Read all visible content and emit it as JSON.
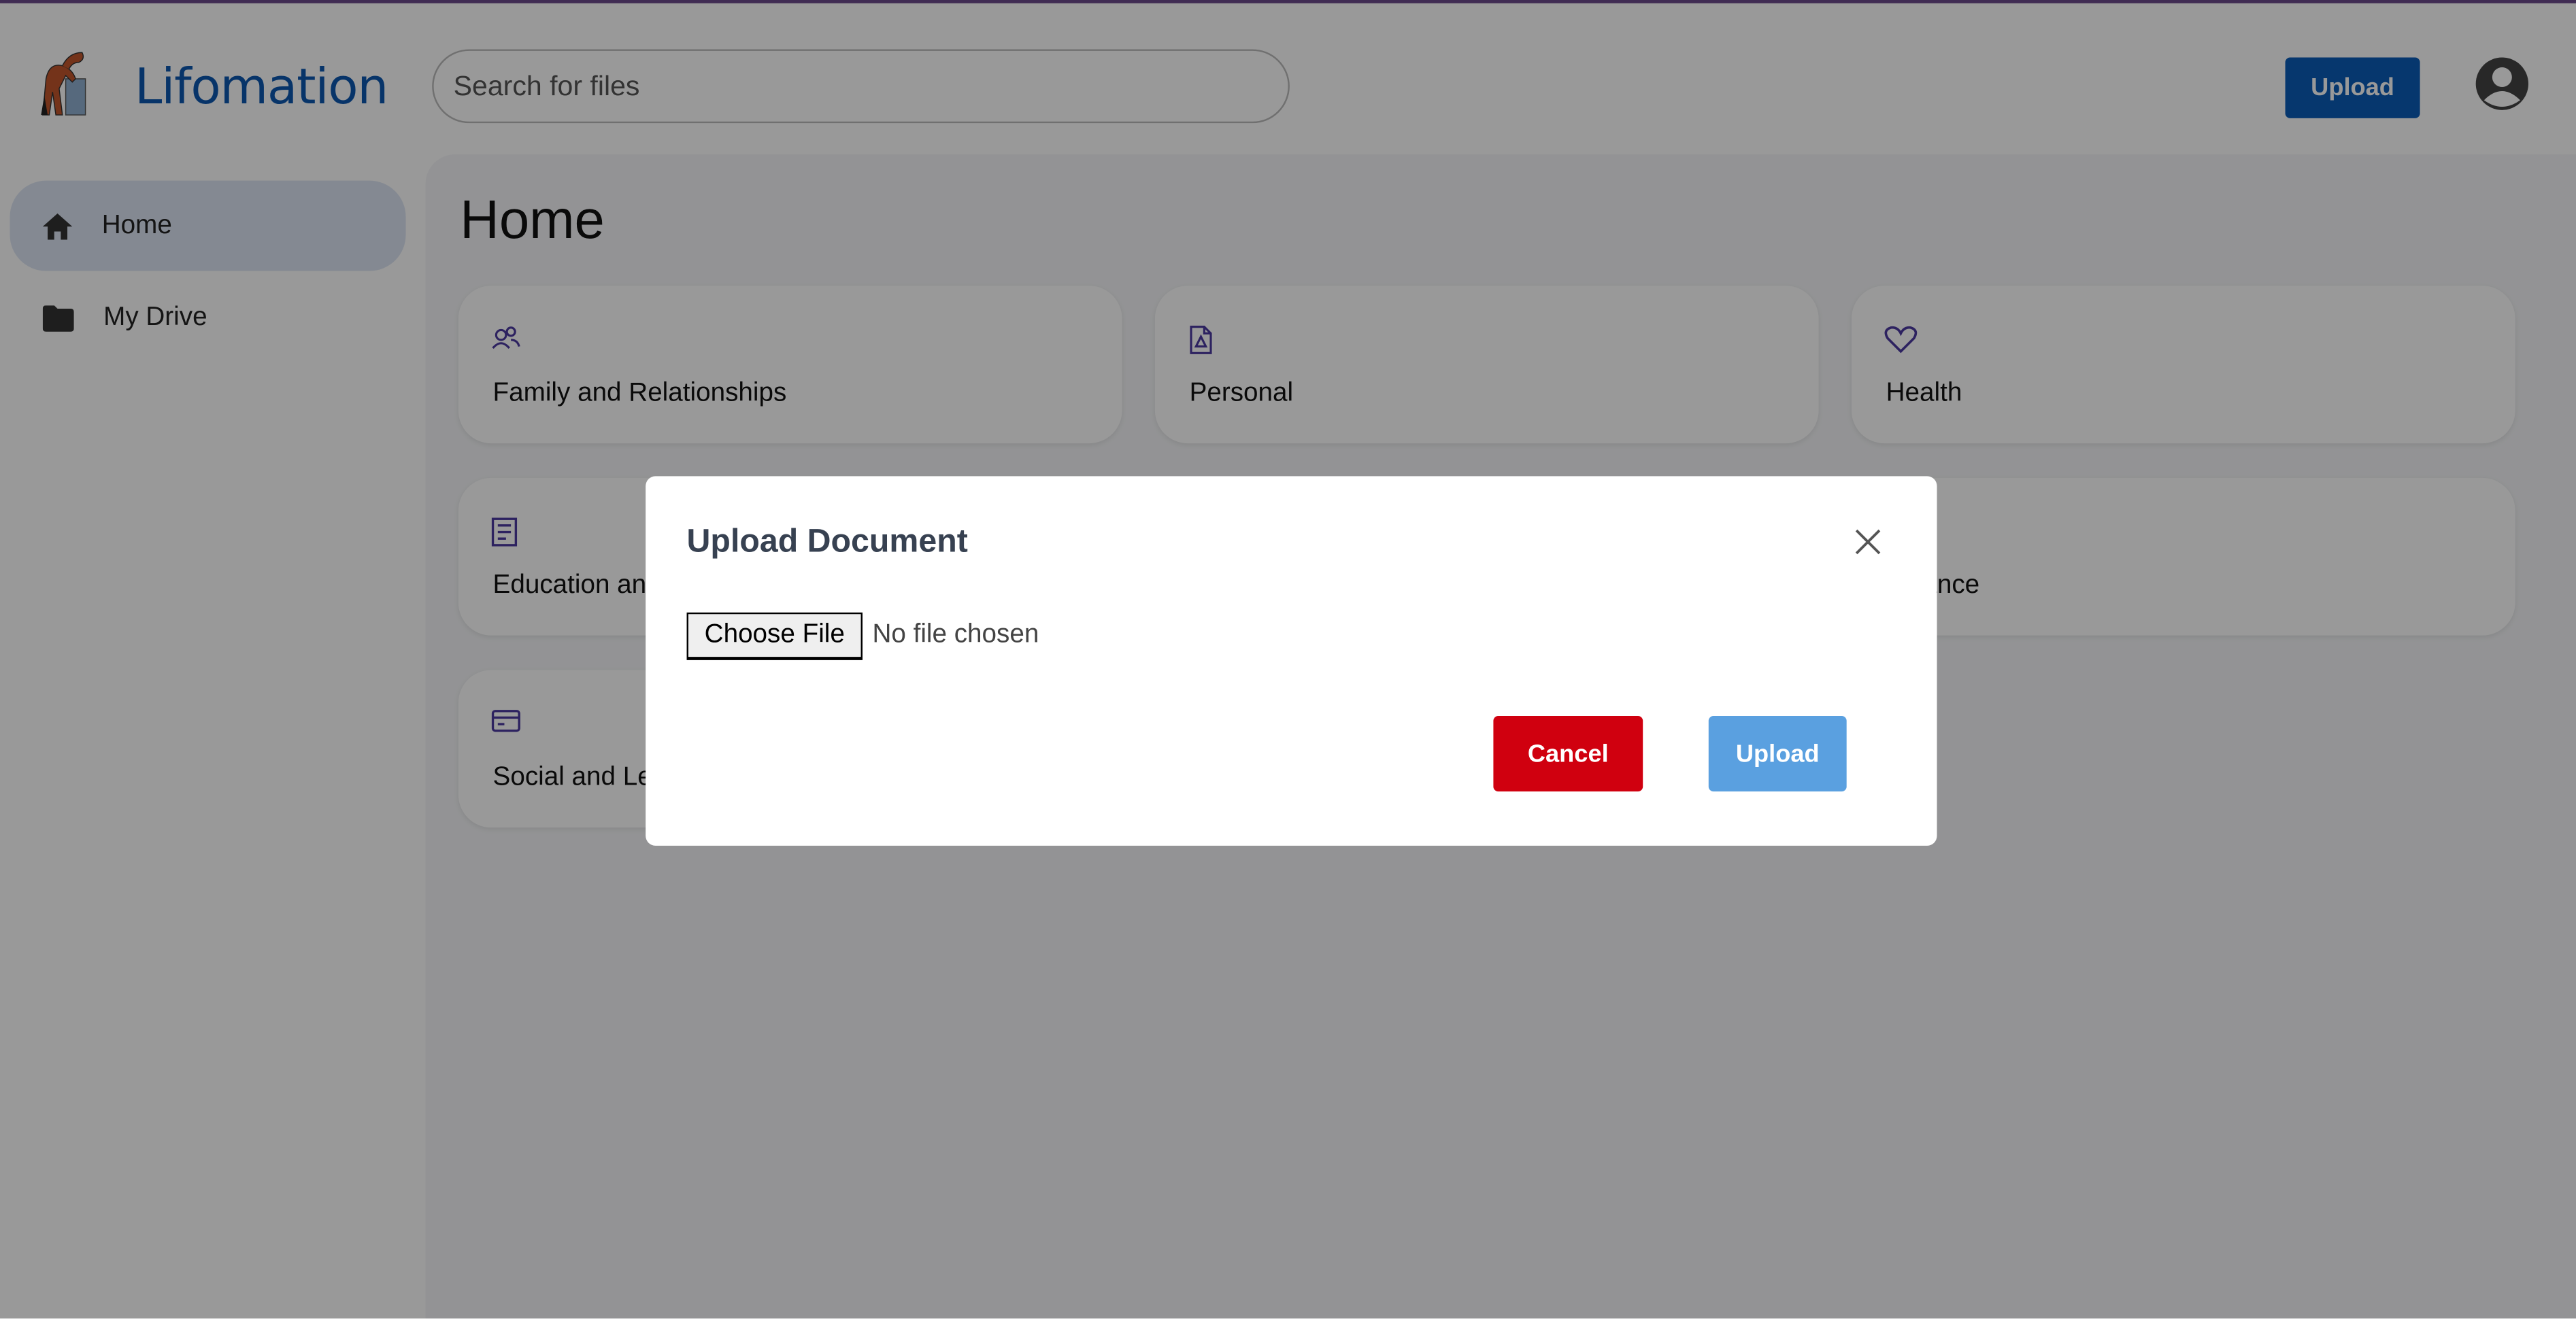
{
  "header": {
    "brand": "Lifomation",
    "search_placeholder": "Search for files",
    "upload_label": "Upload",
    "brand_color": "#0d57b0"
  },
  "sidebar": {
    "items": [
      {
        "label": "Home",
        "icon": "home-icon",
        "active": true
      },
      {
        "label": "My Drive",
        "icon": "folder-icon",
        "active": false
      }
    ]
  },
  "main": {
    "title": "Home",
    "categories": [
      {
        "label": "Family and Relationships",
        "icon": "users-icon"
      },
      {
        "label": "Personal",
        "icon": "file-pdf-icon"
      },
      {
        "label": "Health",
        "icon": "heart-icon"
      },
      {
        "label": "Education and Career",
        "icon": "book-icon"
      },
      {
        "label": "Finance",
        "icon": "wallet-icon"
      },
      {
        "label": "Social and Legal",
        "icon": "credit-card-icon"
      }
    ]
  },
  "modal": {
    "title": "Upload Document",
    "choose_file_label": "Choose File",
    "file_status": "No file chosen",
    "cancel_label": "Cancel",
    "upload_label": "Upload",
    "cancel_color": "#d0000f",
    "upload_color": "#5aa0e0"
  }
}
